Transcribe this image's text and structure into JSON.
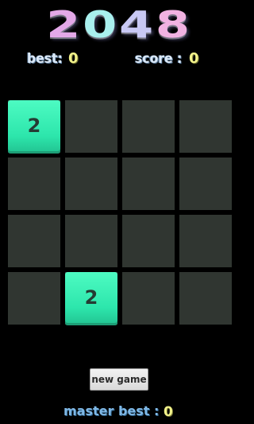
{
  "title": [
    "2",
    "0",
    "4",
    "8"
  ],
  "scores": {
    "best_label": "best:",
    "best_value": "0",
    "score_label": "score :",
    "score_value": "0"
  },
  "board": {
    "rows": 4,
    "cols": 4,
    "tiles": [
      [
        "2",
        "",
        "",
        ""
      ],
      [
        "",
        "",
        "",
        ""
      ],
      [
        "",
        "",
        "",
        ""
      ],
      [
        "",
        "2",
        "",
        ""
      ]
    ]
  },
  "new_game_label": "new game",
  "master": {
    "label": "master best :",
    "value": "0"
  },
  "colors": {
    "background": "#000000",
    "empty_cell": "#303631",
    "tile_2": "#3af0b5",
    "score_value": "#f2f28a"
  }
}
